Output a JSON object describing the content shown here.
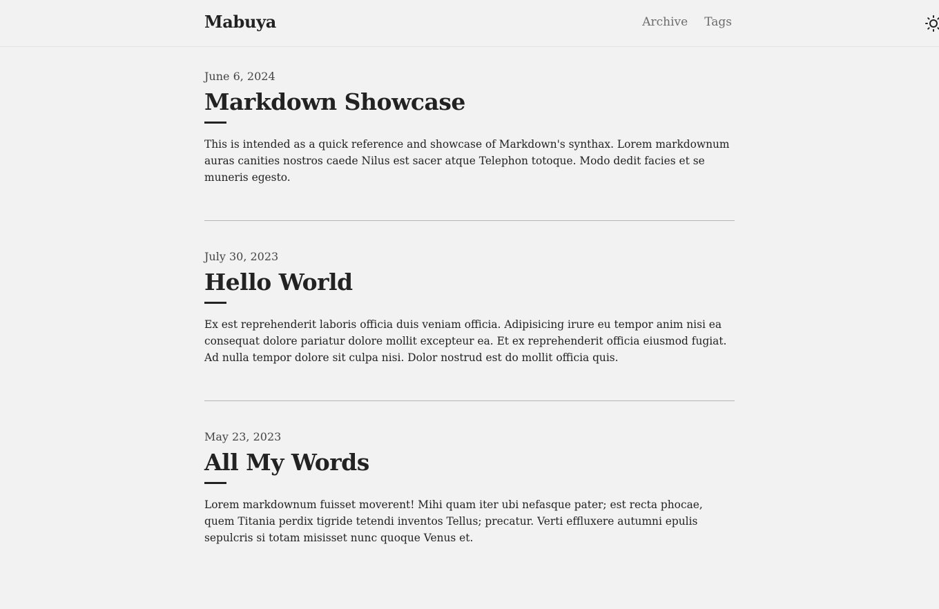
{
  "header": {
    "site_title": "Mabuya",
    "nav": [
      "Archive",
      "Tags"
    ],
    "theme_icon": "sun-icon"
  },
  "posts": [
    {
      "date": "June 6, 2024",
      "title": "Markdown Showcase",
      "excerpt": "This is intended as a quick reference and showcase of Markdown's synthax. Lorem markdownum auras canities nostros caede Nilus est sacer atque Telephon totoque. Modo dedit facies et se muneris egesto."
    },
    {
      "date": "July 30, 2023",
      "title": "Hello World",
      "excerpt": "Ex est reprehenderit laboris officia duis veniam officia. Adipisicing irure eu tempor anim nisi ea consequat dolore pariatur dolore mollit excepteur ea. Et ex reprehenderit officia eiusmod fugiat. Ad nulla tempor dolore sit culpa nisi. Dolor nostrud est do mollit officia quis."
    },
    {
      "date": "May 23, 2023",
      "title": "All My Words",
      "excerpt": "Lorem markdownum fuisset moverent! Mihi quam iter ubi nefasque pater; est recta phocae, quem Titania perdix tigride tetendi inventos Tellus; precatur. Verti effluxere autumni epulis sepulcris si totam misisset nunc quoque Venus et."
    }
  ]
}
